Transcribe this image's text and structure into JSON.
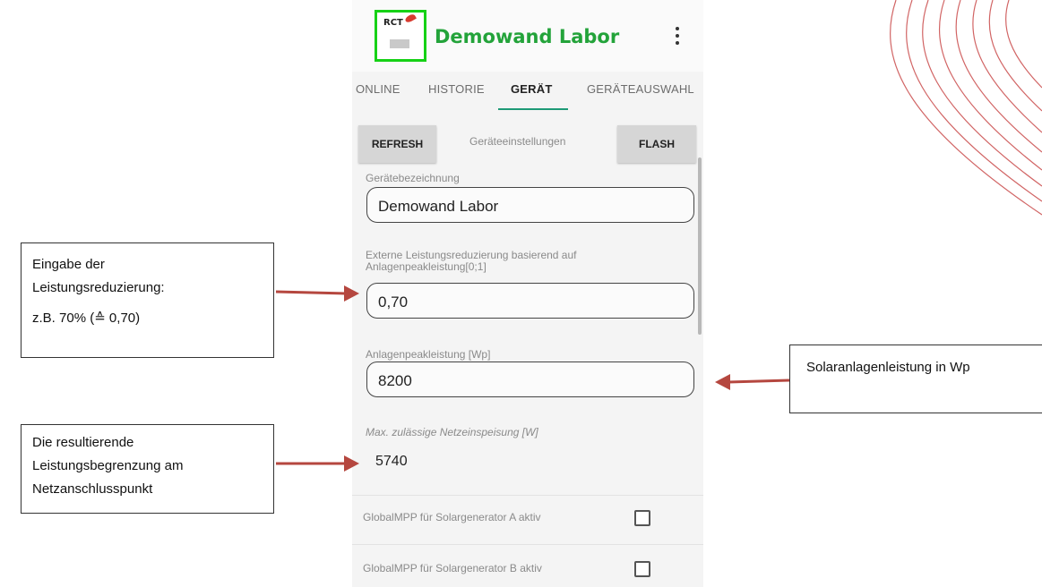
{
  "app": {
    "title": "Demowand Labor",
    "logo_text": "RCT",
    "menu_icon": "more-vertical-icon"
  },
  "tabs": [
    {
      "label": "ONLINE",
      "active": false
    },
    {
      "label": "HISTORIE",
      "active": false
    },
    {
      "label": "GERÄT",
      "active": true
    },
    {
      "label": "GERÄTEAUSWAHL",
      "active": false
    }
  ],
  "toolbar": {
    "refresh_label": "REFRESH",
    "section_label": "Geräteeinstellungen",
    "flash_label": "FLASH"
  },
  "fields": {
    "device_name": {
      "label": "Gerätebezeichnung",
      "value": "Demowand Labor"
    },
    "power_reduction": {
      "label_line1": "Externe Leistungsreduzierung basierend auf",
      "label_line2": "Anlagenpeakleistung[0;1]",
      "value": "0,70"
    },
    "peak_power": {
      "label": "Anlagenpeakleistung [Wp]",
      "value": "8200"
    },
    "max_feed": {
      "label": "Max. zulässige Netzeinspeisung [W]",
      "value": "5740"
    }
  },
  "checkboxes": [
    {
      "label": "GlobalMPP für Solargenerator A aktiv",
      "checked": false
    },
    {
      "label": "GlobalMPP für Solargenerator B aktiv",
      "checked": false
    }
  ],
  "annotations": {
    "left_top": {
      "line1": "Eingabe der",
      "line2": "Leistungsreduzierung:",
      "line3": "z.B. 70% (≙ 0,70)"
    },
    "right": {
      "line1": "Solaranlagenleistung in Wp"
    },
    "left_bottom": {
      "line1": "Die resultierende",
      "line2": "Leistungsbegrenzung am",
      "line3": "Netzanschlusspunkt"
    }
  },
  "colors": {
    "accent_green": "#23a33a",
    "logo_border": "#16d116",
    "tab_indicator": "#1e9a76",
    "arrow_red": "#b5473f"
  }
}
